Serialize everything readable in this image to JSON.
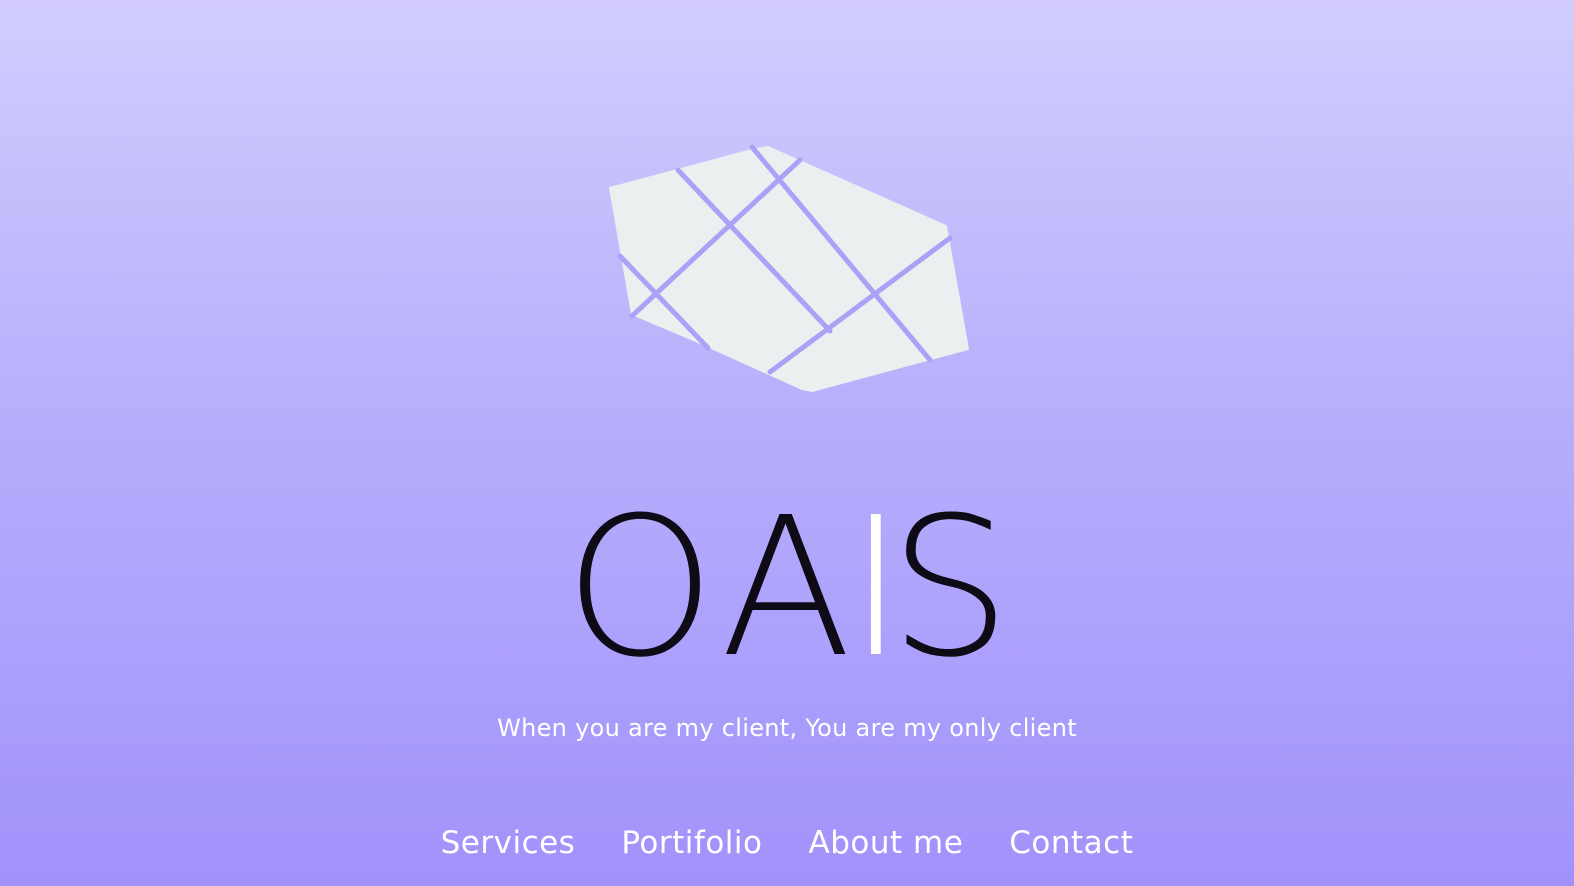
{
  "brand": {
    "letters": [
      "O",
      "A",
      "I",
      "S"
    ],
    "colors": {
      "dark": "#0e0b16",
      "light": "#ffffff"
    }
  },
  "logo": {
    "icon": "faceted-gem-icon",
    "fill": "#ebeff0",
    "line_color": "#a8a3f6"
  },
  "tagline": "When you are my client, You are my only client",
  "nav": {
    "items": [
      {
        "label": "Services"
      },
      {
        "label": "Portifolio"
      },
      {
        "label": "About me"
      },
      {
        "label": "Contact"
      }
    ]
  },
  "colors": {
    "bg_top": "#d2cdfe",
    "bg_bottom": "#a192fb",
    "text_light": "#ffffff"
  }
}
